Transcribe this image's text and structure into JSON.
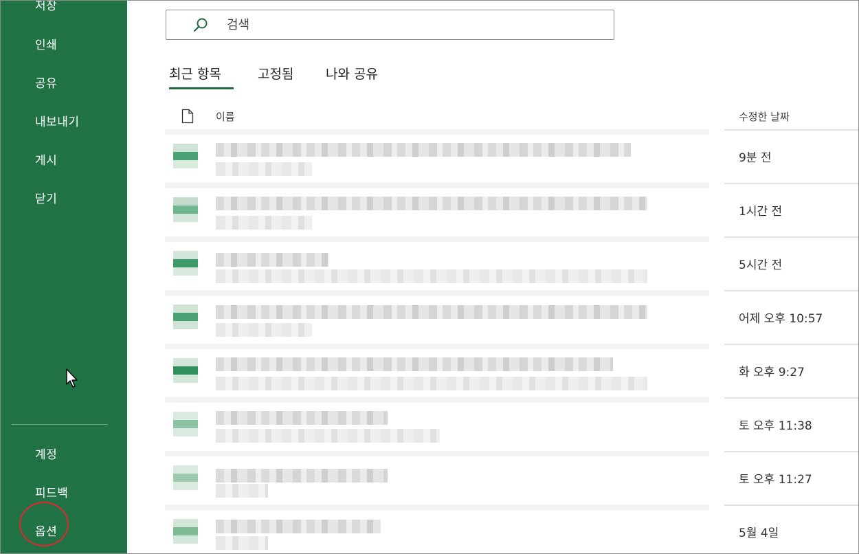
{
  "sidebar": {
    "items": [
      {
        "label": "저장"
      },
      {
        "label": "인쇄"
      },
      {
        "label": "공유"
      },
      {
        "label": "내보내기"
      },
      {
        "label": "게시"
      },
      {
        "label": "닫기"
      }
    ],
    "bottom_items": [
      {
        "label": "계정"
      },
      {
        "label": "피드백"
      },
      {
        "label": "옵션"
      }
    ],
    "background_color": "#217346"
  },
  "search": {
    "placeholder": "검색"
  },
  "tabs": [
    {
      "label": "최근 항목",
      "active": true
    },
    {
      "label": "고정됨",
      "active": false
    },
    {
      "label": "나와 공유",
      "active": false
    }
  ],
  "list": {
    "columns": {
      "name": "이름",
      "modified": "수정한 날짜"
    },
    "rows": [
      {
        "modified": "9분 전",
        "icon": "excel-file-icon"
      },
      {
        "modified": "1시간 전",
        "icon": "excel-file-icon"
      },
      {
        "modified": "5시간 전",
        "icon": "excel-file-icon"
      },
      {
        "modified": "어제 오후 10:57",
        "icon": "excel-file-icon"
      },
      {
        "modified": "화 오후 9:27",
        "icon": "excel-file-icon"
      },
      {
        "modified": "토 오후 11:38",
        "icon": "excel-file-icon"
      },
      {
        "modified": "토 오후 11:27",
        "icon": "excel-file-icon"
      },
      {
        "modified": "5월 4일",
        "icon": "excel-file-icon"
      }
    ]
  },
  "colors": {
    "accent": "#1e6b3b",
    "highlight": "#e3262d"
  }
}
